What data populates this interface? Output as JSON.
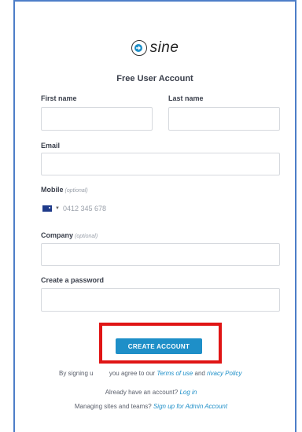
{
  "brand": {
    "logo_text": "sine"
  },
  "form": {
    "title": "Free User Account",
    "first_name_label": "First name",
    "last_name_label": "Last name",
    "email_label": "Email",
    "mobile_label": "Mobile",
    "mobile_optional": "(optional)",
    "mobile_placeholder": "0412 345 678",
    "company_label": "Company",
    "company_optional": "(optional)",
    "password_label": "Create a password",
    "submit_label": "CREATE ACCOUNT"
  },
  "terms": {
    "prefix": "By signing u",
    "mid": "you agree to our ",
    "terms_link": "Terms of use",
    "and": " and ",
    "privacy_link": "rivacy Policy"
  },
  "footer": {
    "login_prompt": "Already have an account?",
    "login_link": "Log in",
    "admin_prompt": "Managing sites and teams?",
    "admin_link": "Sign up for Admin Account"
  },
  "colors": {
    "accent": "#1e8fc8",
    "highlight": "#e01515",
    "frame": "#4d7ec8"
  }
}
